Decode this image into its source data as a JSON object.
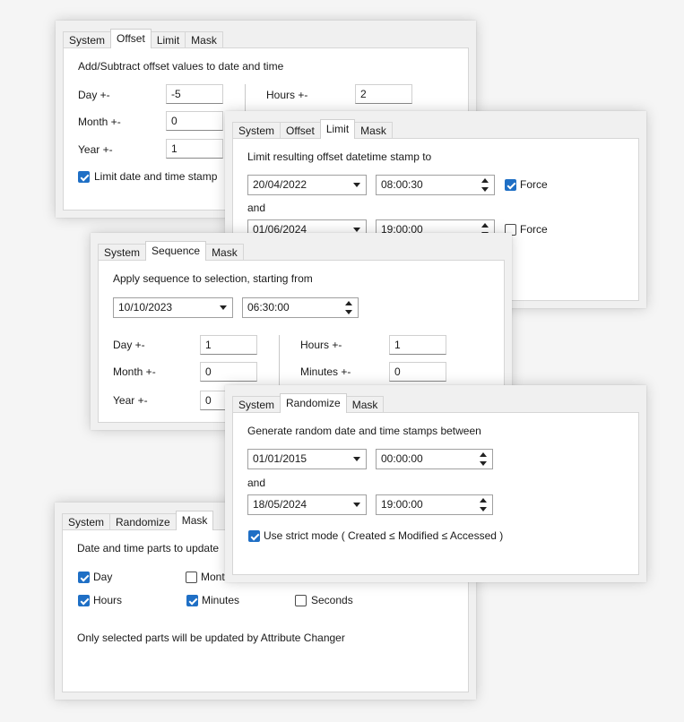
{
  "offset": {
    "tabs": [
      "System",
      "Offset",
      "Limit",
      "Mask"
    ],
    "heading": "Add/Subtract offset values to date and time",
    "day_label": "Day +-",
    "day_value": "-5",
    "month_label": "Month +-",
    "month_value": "0",
    "year_label": "Year +-",
    "year_value": "1",
    "hours_label": "Hours +-",
    "hours_value": "2",
    "limit_label": "Limit date and time stamp"
  },
  "limit": {
    "tabs": [
      "System",
      "Offset",
      "Limit",
      "Mask"
    ],
    "heading": "Limit resulting offset datetime stamp to",
    "date1": "20/04/2022",
    "time1": "08:00:30",
    "force_label": "Force",
    "and_label": "and",
    "date2": "01/06/2024",
    "time2": "19:00:00",
    "force2_label": "Force"
  },
  "sequence": {
    "tabs": [
      "System",
      "Sequence",
      "Mask"
    ],
    "heading": "Apply sequence to selection, starting from",
    "date": "10/10/2023",
    "time": "06:30:00",
    "day_label": "Day +-",
    "day_value": "1",
    "month_label": "Month +-",
    "month_value": "0",
    "year_label": "Year +-",
    "year_value": "0",
    "hours_label": "Hours +-",
    "hours_value": "1",
    "minutes_label": "Minutes +-",
    "minutes_value": "0"
  },
  "randomize": {
    "tabs": [
      "System",
      "Randomize",
      "Mask"
    ],
    "heading": "Generate random date and time stamps between",
    "date1": "01/01/2015",
    "time1": "00:00:00",
    "and_label": "and",
    "date2": "18/05/2024",
    "time2": "19:00:00",
    "strict_label": "Use strict mode ( Created ≤ Modified ≤ Accessed )"
  },
  "mask": {
    "tabs": [
      "System",
      "Randomize",
      "Mask"
    ],
    "heading": "Date and time parts to update",
    "day_label": "Day",
    "month_label": "Mont",
    "hours_label": "Hours",
    "minutes_label": "Minutes",
    "seconds_label": "Seconds",
    "footer": "Only selected parts will be updated by Attribute Changer"
  },
  "colors": {
    "accent": "#1f6fc5",
    "panel": "#f0f0f0",
    "content": "#ffffff"
  }
}
